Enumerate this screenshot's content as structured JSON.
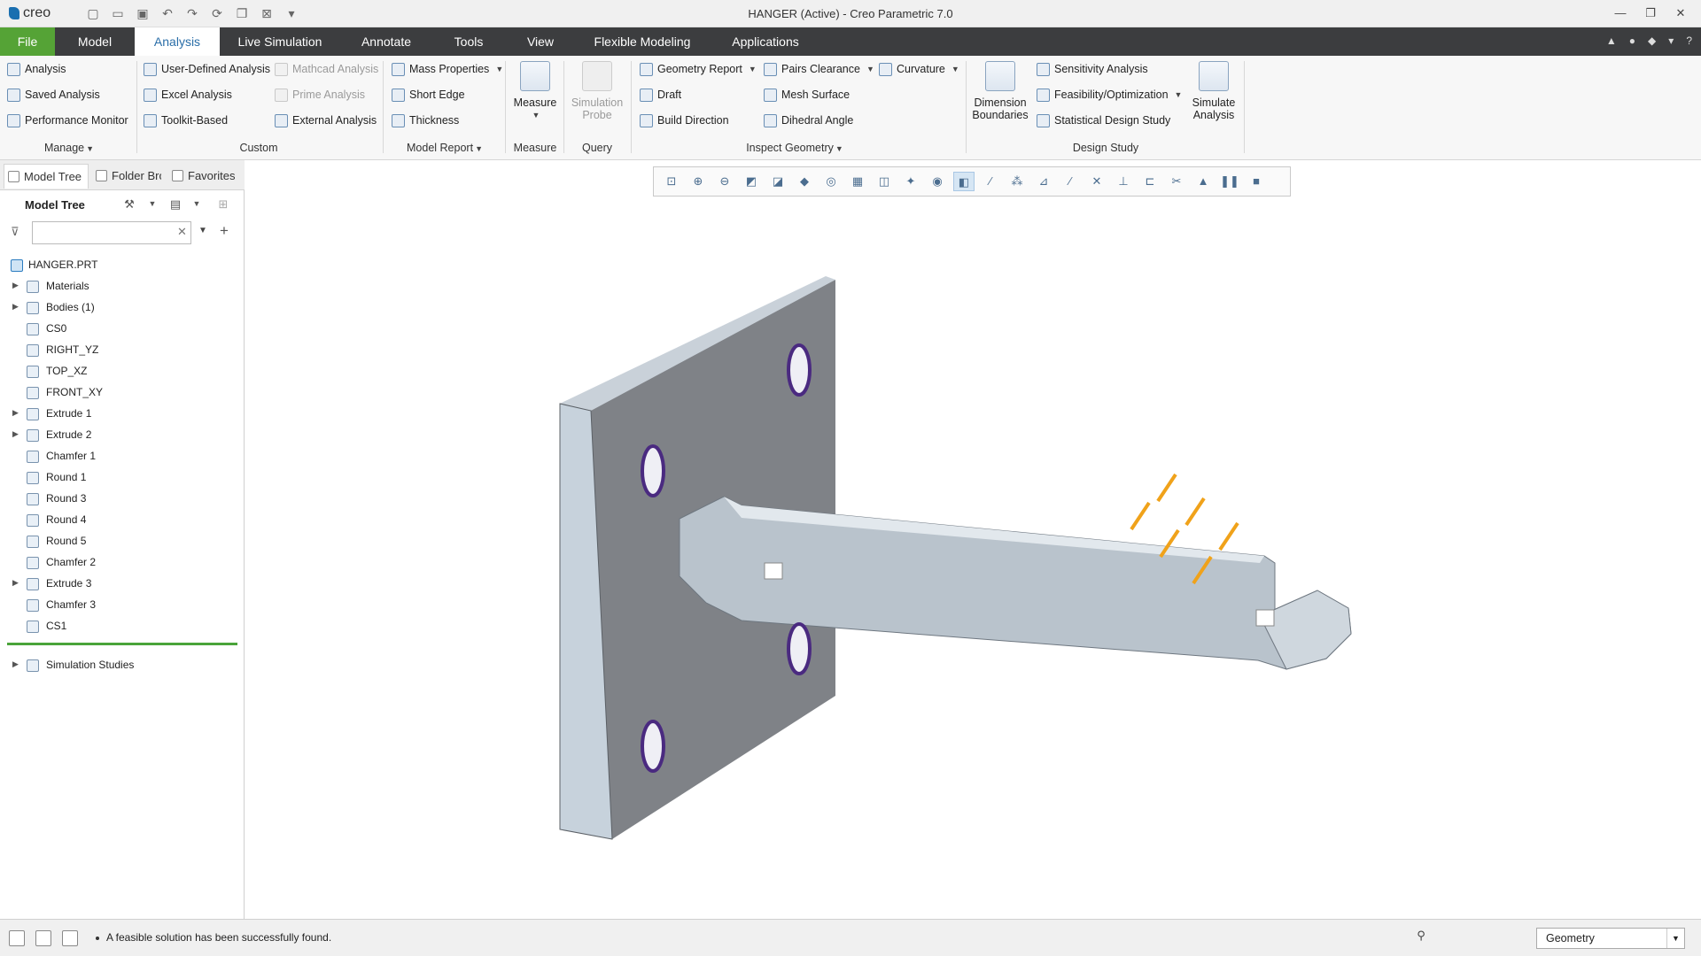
{
  "app": {
    "logo": "creo",
    "title": "HANGER (Active) - Creo Parametric 7.0"
  },
  "tabs": [
    {
      "label": "File"
    },
    {
      "label": "Model"
    },
    {
      "label": "Analysis"
    },
    {
      "label": "Live Simulation"
    },
    {
      "label": "Annotate"
    },
    {
      "label": "Tools"
    },
    {
      "label": "View"
    },
    {
      "label": "Flexible Modeling"
    },
    {
      "label": "Applications"
    }
  ],
  "ribbon": {
    "manage": {
      "analysis": "Analysis",
      "saved_analysis": "Saved Analysis",
      "performance_monitor": "Performance Monitor",
      "group_label": "Manage"
    },
    "custom": {
      "user_defined": "User-Defined Analysis",
      "excel": "Excel Analysis",
      "toolkit": "Toolkit-Based",
      "mathcad": "Mathcad Analysis",
      "prime": "Prime Analysis",
      "external": "External Analysis",
      "group_label": "Custom"
    },
    "model_report": {
      "mass_properties": "Mass Properties",
      "short_edge": "Short Edge",
      "thickness": "Thickness",
      "group_label": "Model Report"
    },
    "measure": {
      "button": "Measure",
      "group_label": "Measure"
    },
    "query": {
      "button": "Simulation Probe",
      "group_label": "Query"
    },
    "inspect": {
      "geometry_report": "Geometry Report",
      "draft": "Draft",
      "build_direction": "Build Direction",
      "pairs_clearance": "Pairs Clearance",
      "mesh_surface": "Mesh Surface",
      "dihedral_angle": "Dihedral Angle",
      "curvature": "Curvature",
      "group_label": "Inspect Geometry"
    },
    "design_study": {
      "dimension_boundaries": "Dimension Boundaries",
      "sensitivity": "Sensitivity Analysis",
      "feasibility": "Feasibility/Optimization",
      "statistical": "Statistical Design Study",
      "simulate": "Simulate Analysis",
      "group_label": "Design Study"
    }
  },
  "panel": {
    "tabs": [
      "Model Tree",
      "Folder Browser",
      "Favorites"
    ],
    "tree_header": "Model Tree",
    "filter_placeholder": "",
    "root": "HANGER.PRT",
    "items": [
      {
        "label": "Materials",
        "expandable": true
      },
      {
        "label": "Bodies (1)",
        "expandable": true
      },
      {
        "label": "CS0",
        "expandable": false
      },
      {
        "label": "RIGHT_YZ",
        "expandable": false
      },
      {
        "label": "TOP_XZ",
        "expandable": false
      },
      {
        "label": "FRONT_XY",
        "expandable": false
      },
      {
        "label": "Extrude 1",
        "expandable": true
      },
      {
        "label": "Extrude 2",
        "expandable": true
      },
      {
        "label": "Chamfer 1",
        "expandable": false
      },
      {
        "label": "Round 1",
        "expandable": false
      },
      {
        "label": "Round 3",
        "expandable": false
      },
      {
        "label": "Round 4",
        "expandable": false
      },
      {
        "label": "Round 5",
        "expandable": false
      },
      {
        "label": "Chamfer 2",
        "expandable": false
      },
      {
        "label": "Extrude 3",
        "expandable": true
      },
      {
        "label": "Chamfer 3",
        "expandable": false
      },
      {
        "label": "CS1",
        "expandable": false
      }
    ],
    "simulation_studies": "Simulation Studies"
  },
  "status": {
    "message": "A feasible solution has been successfully found.",
    "filter_value": "Geometry"
  },
  "colors": {
    "file_tab": "#55a336",
    "tab_bar": "#3c3d3f",
    "accent": "#2a6ea8",
    "load_arrow": "#f0a21a",
    "constraint": "#4a2a80"
  }
}
